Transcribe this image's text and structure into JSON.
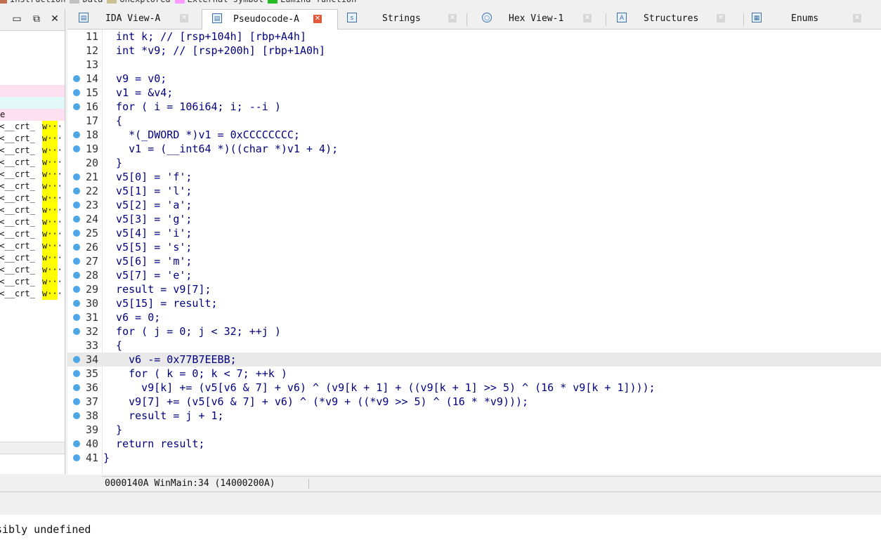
{
  "legend": [
    {
      "label": "Instruction",
      "color": "#c07050"
    },
    {
      "label": "Data",
      "color": "#c0c0c0"
    },
    {
      "label": "Unexplored",
      "color": "#c8c090"
    },
    {
      "label": "External symbol",
      "color": "#ff99ff"
    },
    {
      "label": "Lumina function",
      "color": "#22bb22"
    }
  ],
  "left_panel": {
    "rows_before": [
      "e"
    ],
    "crt_prefix": "r<__crt_",
    "crt_suffix": "w···",
    "row_colors": {
      "pink": "#ffe0f0",
      "cyan": "#e0f8f8",
      "highlight": "#ffff00"
    }
  },
  "tabs": [
    {
      "label": "IDA View-A",
      "icon": "ida-view-icon"
    },
    {
      "label": "Pseudocode-A",
      "icon": "pseudocode-icon",
      "active": true
    },
    {
      "label": "Strings",
      "icon": "strings-icon"
    },
    {
      "label": "Hex View-1",
      "icon": "hex-view-icon"
    },
    {
      "label": "Structures",
      "icon": "structures-icon"
    },
    {
      "label": "Enums",
      "icon": "enums-icon"
    }
  ],
  "code": {
    "lines": [
      {
        "n": "11",
        "dot": false,
        "text": "  int k; // [rsp+104h] [rbp+A4h]"
      },
      {
        "n": "12",
        "dot": false,
        "text": "  int *v9; // [rsp+200h] [rbp+1A0h]"
      },
      {
        "n": "13",
        "dot": false,
        "text": ""
      },
      {
        "n": "14",
        "dot": true,
        "text": "  v9 = v0;"
      },
      {
        "n": "15",
        "dot": true,
        "text": "  v1 = &v4;"
      },
      {
        "n": "16",
        "dot": true,
        "text": "  for ( i = 106i64; i; --i )"
      },
      {
        "n": "17",
        "dot": false,
        "text": "  {"
      },
      {
        "n": "18",
        "dot": true,
        "text": "    *(_DWORD *)v1 = 0xCCCCCCCC;"
      },
      {
        "n": "19",
        "dot": true,
        "text": "    v1 = (__int64 *)((char *)v1 + 4);"
      },
      {
        "n": "20",
        "dot": false,
        "text": "  }"
      },
      {
        "n": "21",
        "dot": true,
        "text": "  v5[0] = 'f';"
      },
      {
        "n": "22",
        "dot": true,
        "text": "  v5[1] = 'l';"
      },
      {
        "n": "23",
        "dot": true,
        "text": "  v5[2] = 'a';"
      },
      {
        "n": "24",
        "dot": true,
        "text": "  v5[3] = 'g';"
      },
      {
        "n": "25",
        "dot": true,
        "text": "  v5[4] = 'i';"
      },
      {
        "n": "26",
        "dot": true,
        "text": "  v5[5] = 's';"
      },
      {
        "n": "27",
        "dot": true,
        "text": "  v5[6] = 'm';"
      },
      {
        "n": "28",
        "dot": true,
        "text": "  v5[7] = 'e';"
      },
      {
        "n": "29",
        "dot": true,
        "text": "  result = v9[7];"
      },
      {
        "n": "30",
        "dot": true,
        "text": "  v5[15] = result;"
      },
      {
        "n": "31",
        "dot": true,
        "text": "  v6 = 0;"
      },
      {
        "n": "32",
        "dot": true,
        "text": "  for ( j = 0; j < 32; ++j )"
      },
      {
        "n": "33",
        "dot": false,
        "text": "  {"
      },
      {
        "n": "34",
        "dot": true,
        "text": "    v6 -= 0x77B7EEBB;",
        "current": true
      },
      {
        "n": "35",
        "dot": true,
        "text": "    for ( k = 0; k < 7; ++k )"
      },
      {
        "n": "36",
        "dot": true,
        "text": "      v9[k] += (v5[v6 & 7] + v6) ^ (v9[k + 1] + ((v9[k + 1] >> 5) ^ (16 * v9[k + 1])));"
      },
      {
        "n": "37",
        "dot": true,
        "text": "    v9[7] += (v5[v6 & 7] + v6) ^ (*v9 + ((*v9 >> 5) ^ (16 * *v9)));"
      },
      {
        "n": "38",
        "dot": true,
        "text": "    result = j + 1;"
      },
      {
        "n": "39",
        "dot": false,
        "text": "  }"
      },
      {
        "n": "40",
        "dot": true,
        "text": "  return result;"
      },
      {
        "n": "41",
        "dot": true,
        "text": "}"
      }
    ]
  },
  "status": {
    "text": "0000140A WinMain:34 (14000200A)"
  },
  "output": {
    "line": "sibly undefined"
  }
}
